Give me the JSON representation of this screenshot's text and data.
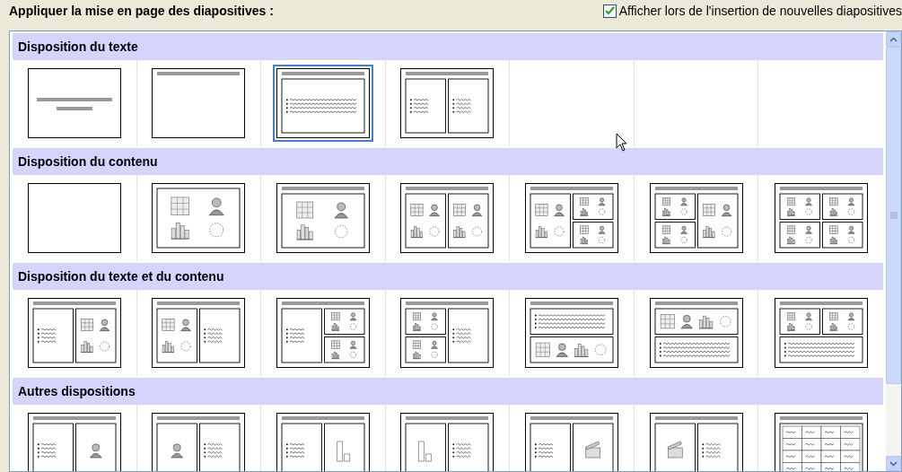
{
  "heading": "Appliquer la mise en page des diapositives :",
  "show_option": {
    "label": "Afficher lors de l'insertion de nouvelles diapositives",
    "checked": true
  },
  "sections": [
    {
      "title": "Disposition du texte",
      "layouts": [
        {
          "kind": "titleslide",
          "selected": false
        },
        {
          "kind": "titleonly",
          "selected": false
        },
        {
          "kind": "titletext",
          "selected": true
        },
        {
          "kind": "twotext",
          "selected": false
        }
      ]
    },
    {
      "title": "Disposition du contenu",
      "layouts": [
        {
          "kind": "blank",
          "selected": false
        },
        {
          "kind": "content",
          "selected": false
        },
        {
          "kind": "titlecontent",
          "selected": false
        },
        {
          "kind": "twocontent",
          "selected": false
        },
        {
          "kind": "contentsplit",
          "selected": false
        },
        {
          "kind": "splitcontent",
          "selected": false
        },
        {
          "kind": "fourcontent",
          "selected": false
        }
      ]
    },
    {
      "title": "Disposition du texte et du contenu",
      "layouts": [
        {
          "kind": "textcontent",
          "selected": false
        },
        {
          "kind": "contenttext",
          "selected": false
        },
        {
          "kind": "textsplit",
          "selected": false
        },
        {
          "kind": "splittext",
          "selected": false
        },
        {
          "kind": "textovercontent",
          "selected": false
        },
        {
          "kind": "contentovertext",
          "selected": false
        },
        {
          "kind": "splitovertext",
          "selected": false
        }
      ]
    },
    {
      "title": "Autres dispositions",
      "layouts": [
        {
          "kind": "textclipart",
          "selected": false
        },
        {
          "kind": "cliparttext",
          "selected": false
        },
        {
          "kind": "textchart",
          "selected": false
        },
        {
          "kind": "charttext",
          "selected": false
        },
        {
          "kind": "textmedia",
          "selected": false
        },
        {
          "kind": "mediatext",
          "selected": false
        },
        {
          "kind": "table",
          "selected": false
        }
      ]
    }
  ]
}
